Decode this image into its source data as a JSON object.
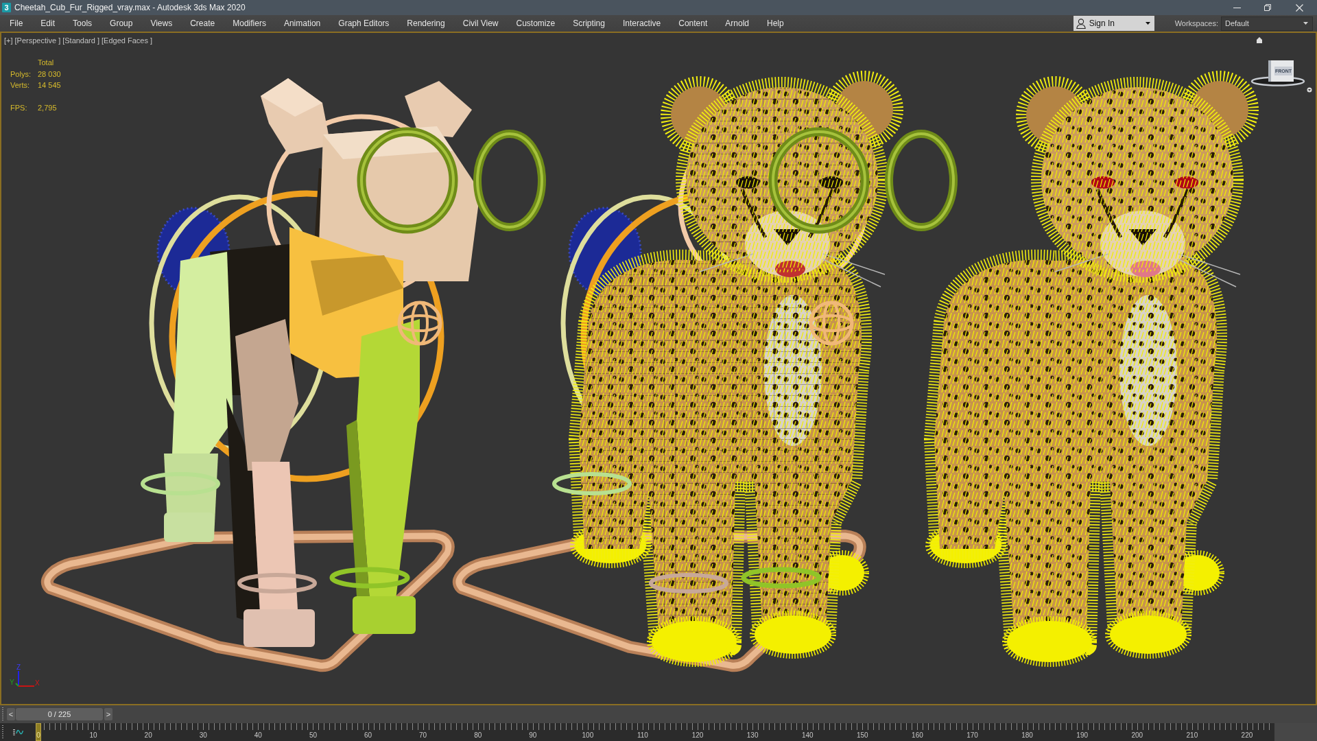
{
  "window": {
    "app_icon": "3",
    "title": "Cheetah_Cub_Fur_Rigged_vray.max - Autodesk 3ds Max 2020"
  },
  "menu_bar": {
    "items": [
      "File",
      "Edit",
      "Tools",
      "Group",
      "Views",
      "Create",
      "Modifiers",
      "Animation",
      "Graph Editors",
      "Rendering",
      "Civil View",
      "Customize",
      "Scripting",
      "Interactive",
      "Content",
      "Arnold",
      "Help"
    ],
    "sign_in": "Sign In",
    "workspaces_label": "Workspaces:",
    "workspace": "Default"
  },
  "viewport": {
    "active": true,
    "labels": [
      "[+]",
      "[Perspective ]",
      "[Standard ]",
      "[Edged Faces ]"
    ],
    "stats": {
      "heading": "Total",
      "rows": [
        {
          "label": "Polys:",
          "value": "28 030"
        },
        {
          "label": "Verts:",
          "value": "14 545"
        }
      ],
      "fps_label": "FPS:",
      "fps": "2,795"
    },
    "view_cube": {
      "face": "FRONT"
    },
    "axes": {
      "z": "Z",
      "y": "Y",
      "x": "X"
    },
    "models": [
      {
        "kind": "rig"
      },
      {
        "kind": "rigged_fur"
      },
      {
        "kind": "fur"
      }
    ]
  },
  "time_slider": {
    "prev": "<",
    "thumb": "0 / 225",
    "next": ">",
    "level": 0
  },
  "track_bar": {
    "current_frame": {
      "label": "0",
      "level": 0
    },
    "frame_labels": [
      "10",
      "20",
      "30",
      "40",
      "50",
      "60",
      "70",
      "80",
      "90",
      "100",
      "110",
      "120",
      "130",
      "140",
      "150",
      "160",
      "170",
      "180",
      "190",
      "200",
      "210",
      "220"
    ]
  }
}
